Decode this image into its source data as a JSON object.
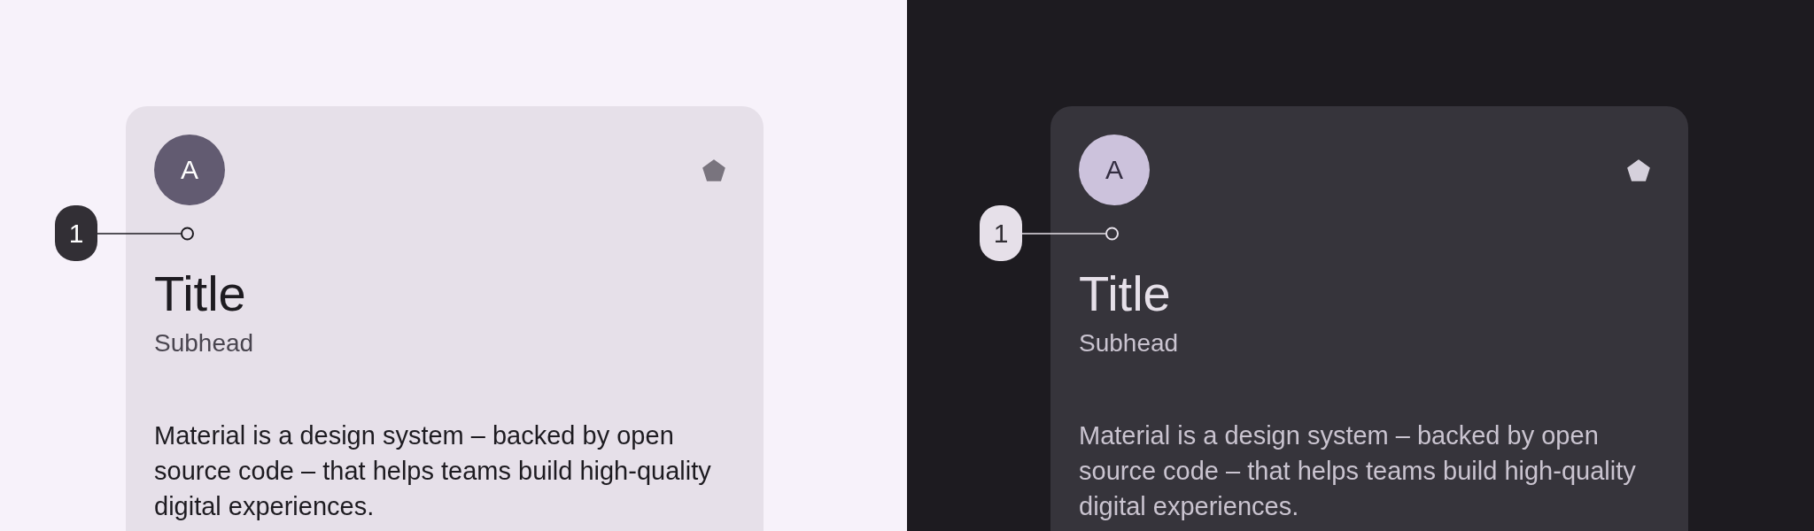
{
  "panels": [
    {
      "kind": "light",
      "annotation": {
        "label": "1"
      },
      "card": {
        "avatar": "A",
        "title": "Title",
        "subhead": "Subhead",
        "body": "Material is a design system – backed by open source code – that helps teams build high-quality digital experiences."
      }
    },
    {
      "kind": "dark",
      "annotation": {
        "label": "1"
      },
      "card": {
        "avatar": "A",
        "title": "Title",
        "subhead": "Subhead",
        "body": "Material is a design system – backed by open source code – that helps teams build high-quality digital experiences."
      }
    }
  ]
}
